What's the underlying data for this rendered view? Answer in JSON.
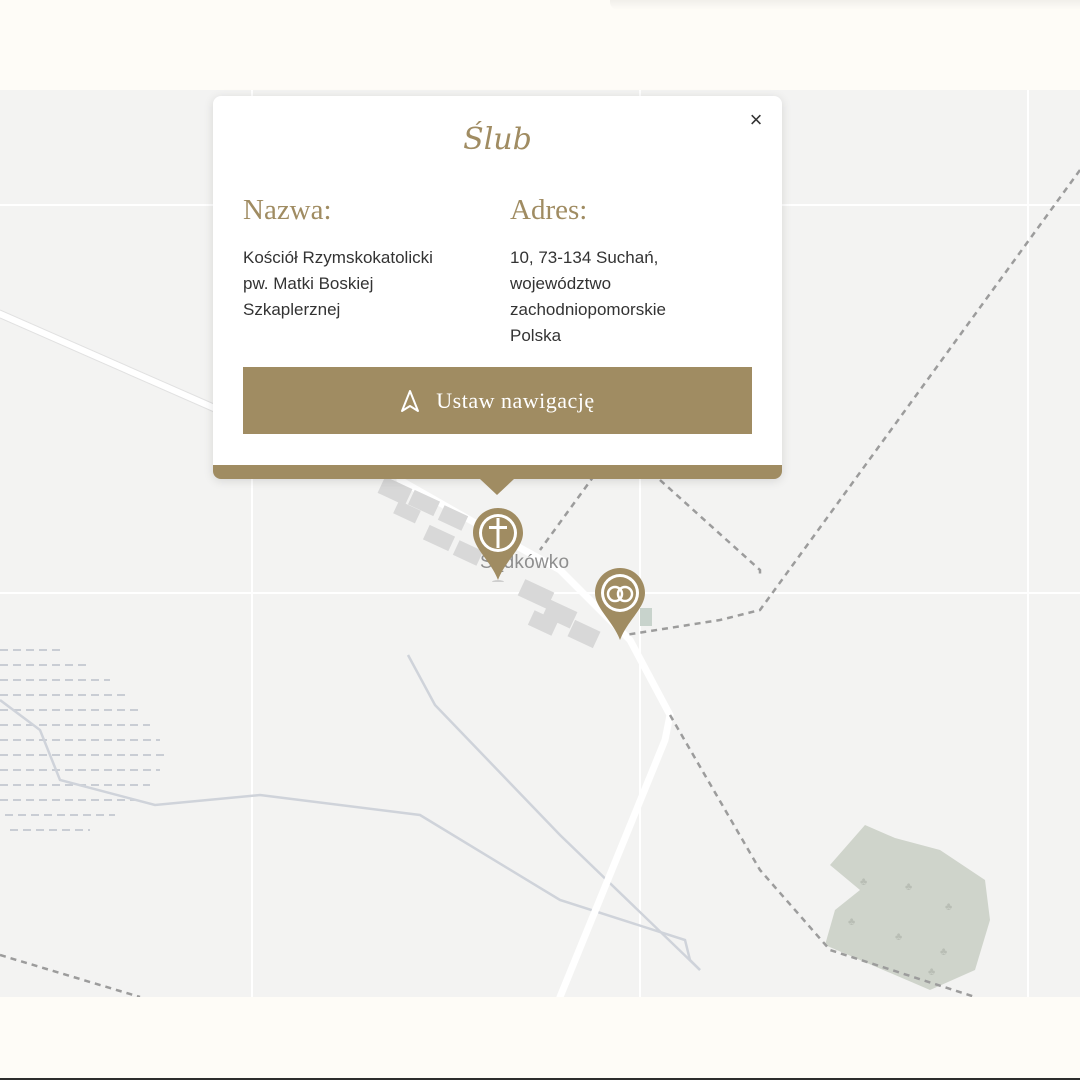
{
  "map": {
    "place_label": "Sądkówko"
  },
  "popup": {
    "title": "Ślub",
    "close_symbol": "×",
    "name_heading": "Nazwa:",
    "name_text": "Kościół Rzymskokatolicki\npw. Matki Boskiej\nSzkaplerznej",
    "address_heading": "Adres:",
    "address_text": "10, 73-134 Suchań,\nwojewództwo\nzachodniopomorskie\nPolska",
    "nav_button_label": "Ustaw nawigację"
  },
  "markers": [
    {
      "name": "church-marker",
      "icon": "cross-icon"
    },
    {
      "name": "wedding-marker",
      "icon": "rings-icon"
    }
  ],
  "colors": {
    "accent": "#a08c62",
    "map_bg": "#f3f3f2",
    "page_bg": "#fefdf9"
  }
}
